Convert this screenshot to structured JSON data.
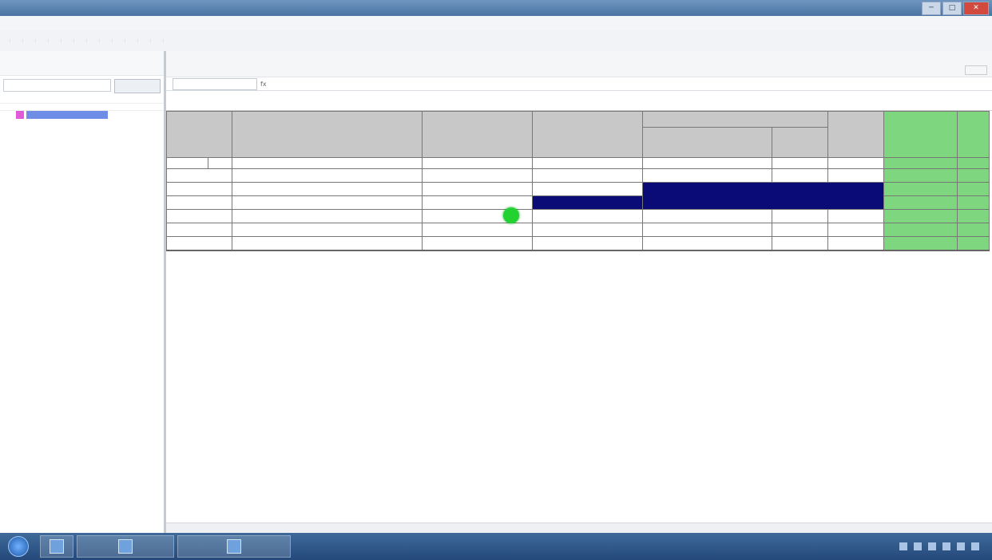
{
  "window": {
    "title": "",
    "btn_min": "─",
    "btn_max": "□",
    "btn_close": "✕"
  },
  "menubar": [
    "",
    "",
    "",
    "",
    "",
    "",
    "",
    ""
  ],
  "toolbar": {
    "buttons": [
      "",
      "",
      "",
      "",
      "",
      "",
      "",
      "",
      "",
      "",
      "",
      "",
      ""
    ]
  },
  "sidebar": {
    "title": "",
    "search_placeholder": "",
    "search_button": "",
    "tabs": [
      "",
      ""
    ],
    "columns": [
      "",
      ""
    ],
    "tree_items": [
      ""
    ]
  },
  "content": {
    "toolbar2": [
      "",
      "",
      "",
      "",
      "",
      "",
      "",
      ""
    ],
    "toolbar3": [
      "",
      "",
      "",
      "",
      "",
      "",
      "",
      "",
      "",
      "",
      ""
    ],
    "formula": {
      "cell_ref": "",
      "fx": "fx"
    },
    "markers": [
      "",
      ""
    ],
    "table": {
      "headers_row1": [
        "",
        "",
        "",
        "",
        "",
        "",
        "",
        "",
        ""
      ],
      "group_header": "",
      "sub_headers": [
        "",
        ""
      ],
      "index_row": [
        "",
        "",
        "",
        "",
        "",
        "",
        "",
        "",
        "",
        "",
        ""
      ],
      "sub_index": ""
    }
  },
  "taskbar": {
    "clock": ""
  },
  "colors": {
    "header_gray": "#c8c8c8",
    "highlight_green": "#7ed67f",
    "selection_navy": "#0b0b77",
    "status_dot": "#21d231"
  }
}
